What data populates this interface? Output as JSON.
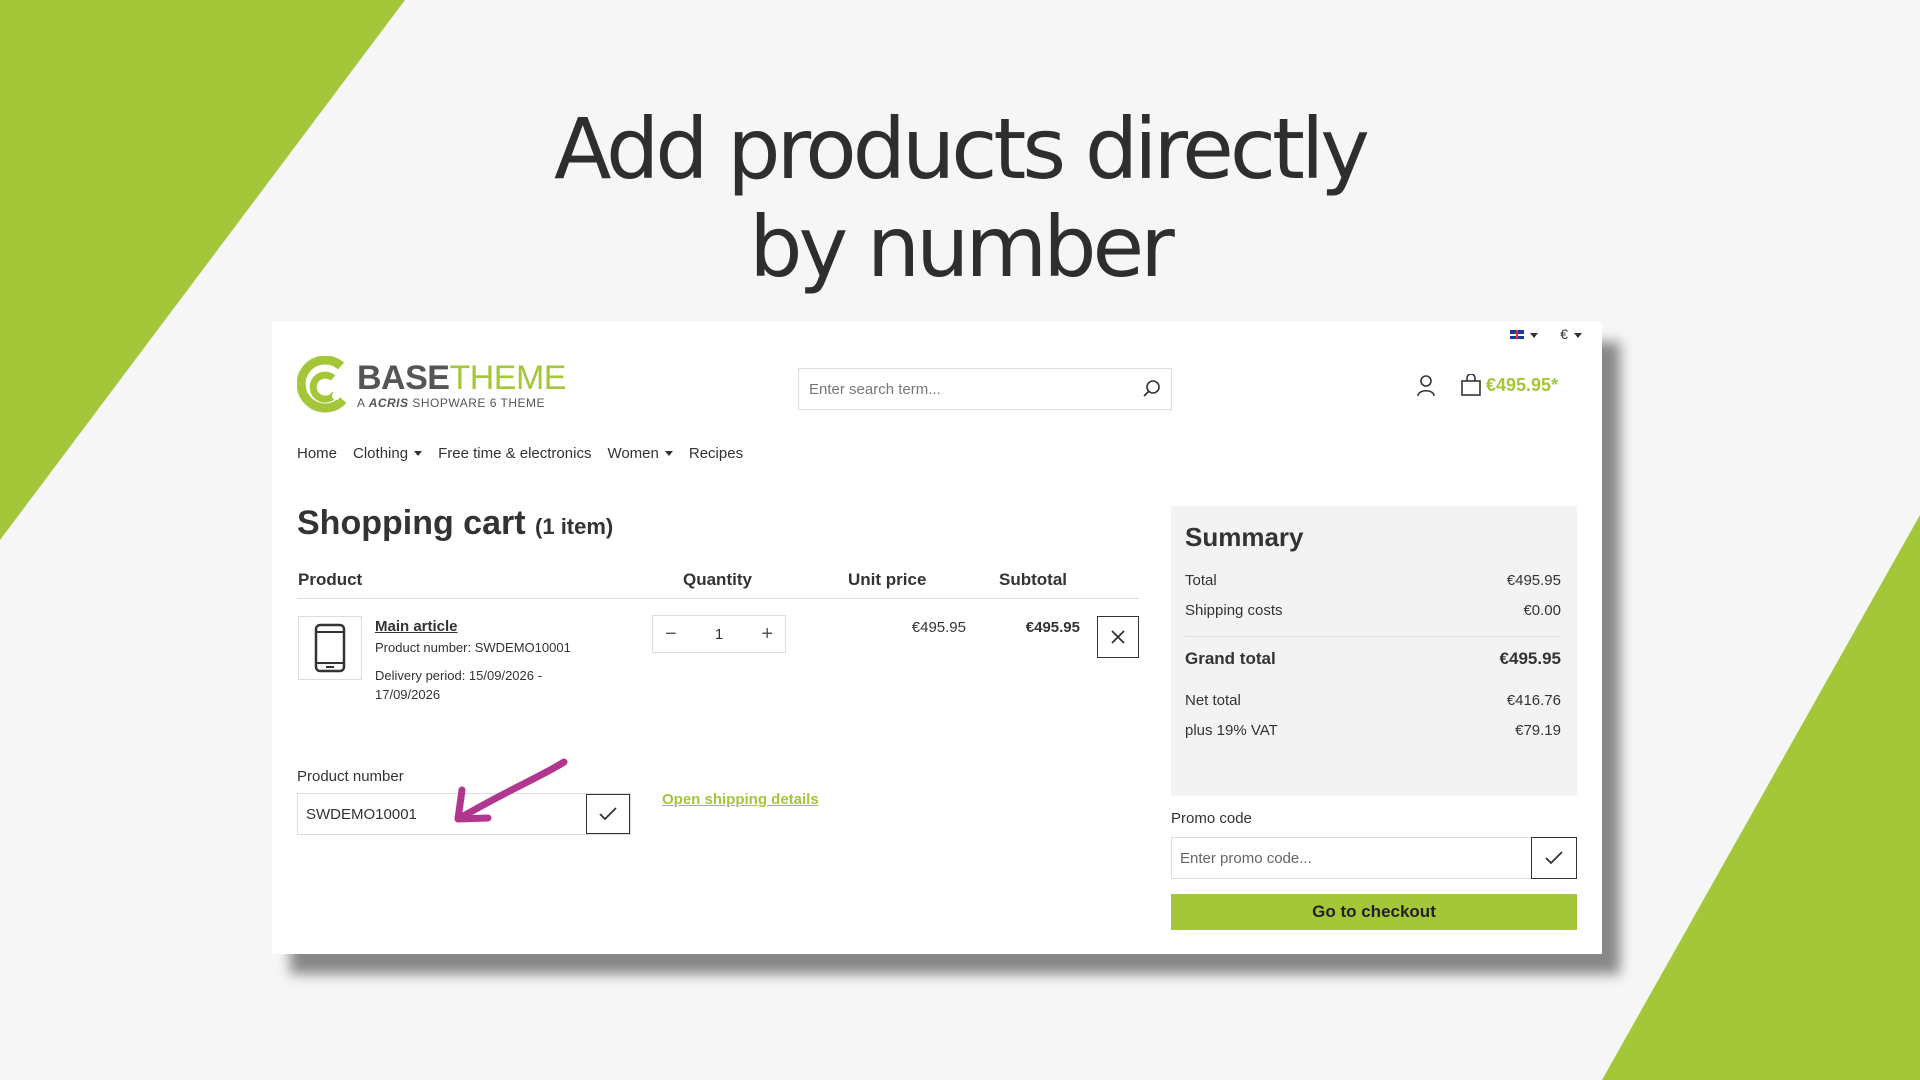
{
  "headline": {
    "line1": "Add products directly",
    "line2": "by number"
  },
  "colors": {
    "accent": "#a4c639",
    "text": "#333333",
    "arrow": "#b0368f"
  },
  "topbar": {
    "language_icon": "uk-flag-icon",
    "currency": "€"
  },
  "logo": {
    "main_bold": "BASE",
    "main_light": "THEME",
    "sub_prefix": "A ",
    "sub_brand": "ACRIS",
    "sub_suffix": " SHOPWARE 6 THEME"
  },
  "search": {
    "placeholder": "Enter search term..."
  },
  "header": {
    "cart_total": "€495.95*"
  },
  "nav": {
    "items": [
      "Home",
      "Clothing",
      "Free time & electronics",
      "Women",
      "Recipes"
    ]
  },
  "cart": {
    "title": "Shopping cart",
    "count": "(1 item)",
    "columns": {
      "product": "Product",
      "quantity": "Quantity",
      "unit_price": "Unit price",
      "subtotal": "Subtotal"
    },
    "item": {
      "name": "Main article",
      "number": "Product number: SWDEMO10001",
      "delivery_line1": "Delivery period: 15/09/2026 -",
      "delivery_line2": "17/09/2026",
      "quantity": "1",
      "unit_price": "€495.95",
      "subtotal": "€495.95"
    }
  },
  "add_by_number": {
    "label": "Product number",
    "value": "SWDEMO10001"
  },
  "shipping_link": "Open shipping details",
  "summary": {
    "title": "Summary",
    "total_label": "Total",
    "total_value": "€495.95",
    "shipping_label": "Shipping costs",
    "shipping_value": "€0.00",
    "grand_label": "Grand total",
    "grand_value": "€495.95",
    "net_label": "Net total",
    "net_value": "€416.76",
    "vat_label": "plus 19% VAT",
    "vat_value": "€79.19"
  },
  "promo": {
    "label": "Promo code",
    "placeholder": "Enter promo code..."
  },
  "checkout_label": "Go to checkout"
}
